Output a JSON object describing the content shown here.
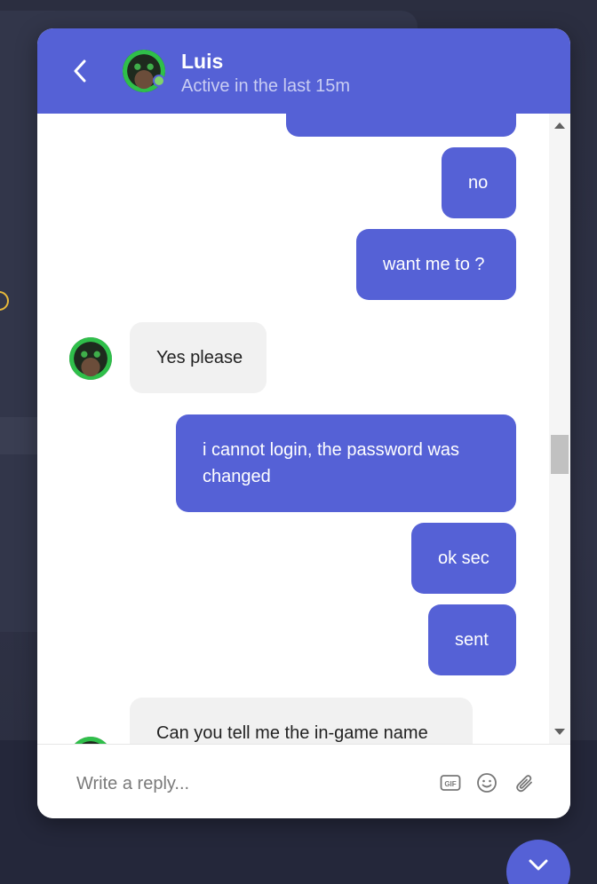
{
  "contact": {
    "name": "Luis",
    "status": "Active in the last 15m"
  },
  "messages": [
    {
      "direction": "out",
      "text": "no"
    },
    {
      "direction": "out",
      "text": "want me to ?"
    },
    {
      "direction": "in",
      "text": "Yes please"
    },
    {
      "direction": "out",
      "text": "i cannot login, the password was changed"
    },
    {
      "direction": "out",
      "text": "ok sec"
    },
    {
      "direction": "out",
      "text": "sent"
    },
    {
      "direction": "in",
      "text": "Can you tell me the in-game name"
    }
  ],
  "composer": {
    "placeholder": "Write a reply..."
  },
  "icons": {
    "back": "chevron-left-icon",
    "gif": "gif-icon",
    "emoji": "emoji-icon",
    "attach": "paperclip-icon",
    "scroll_down": "chevron-down-icon"
  },
  "colors": {
    "accent": "#5561d6",
    "incoming_bubble": "#f1f1f1",
    "online": "#7fd36b"
  }
}
